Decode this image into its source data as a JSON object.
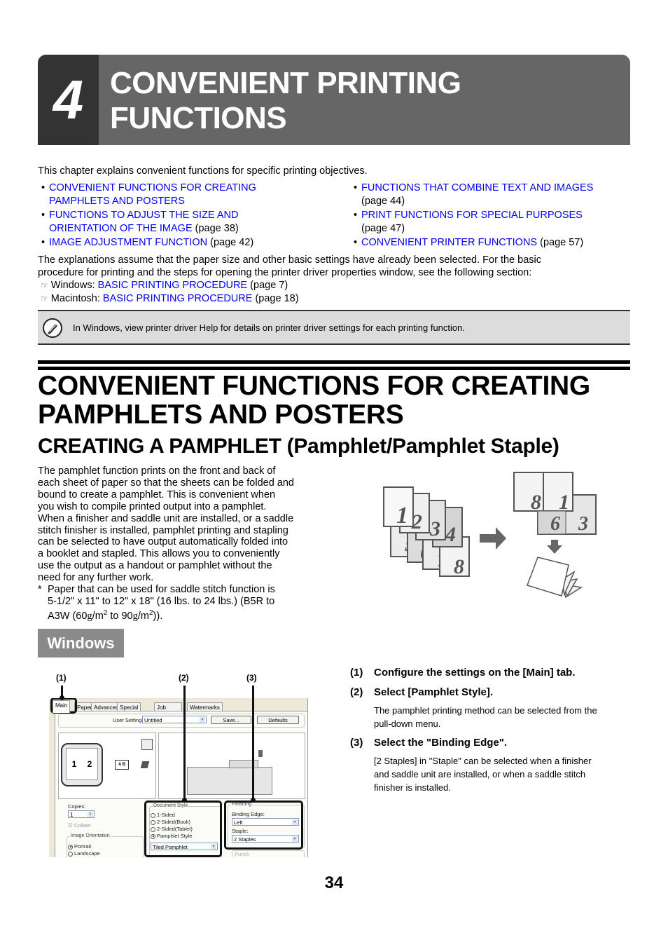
{
  "chapter": {
    "number": "4",
    "title_line1": "CONVENIENT PRINTING",
    "title_line2": "FUNCTIONS"
  },
  "intro": "This chapter explains convenient functions for specific printing objectives.",
  "toc": {
    "left": [
      {
        "link_l1": "CONVENIENT FUNCTIONS FOR CREATING",
        "link_l2": "PAMPHLETS AND POSTERS",
        "page": ""
      },
      {
        "link_l1": "FUNCTIONS TO ADJUST THE SIZE AND",
        "link_l2": "ORIENTATION OF THE IMAGE",
        "page": " (page 38)"
      },
      {
        "link_l1": "IMAGE ADJUSTMENT FUNCTION",
        "link_l2": "",
        "page": " (page 42)"
      }
    ],
    "right": [
      {
        "link": "FUNCTIONS THAT COMBINE TEXT AND IMAGES",
        "page": "(page 44)"
      },
      {
        "link": "PRINT FUNCTIONS FOR SPECIAL PURPOSES",
        "page": "(page 47)"
      },
      {
        "link": "CONVENIENT PRINTER FUNCTIONS",
        "page": " (page 57)"
      }
    ],
    "bullet": "•"
  },
  "assumption": {
    "line1": "The explanations assume that the paper size and other basic settings have already been selected. For the basic",
    "line2": "procedure for printing and the steps for opening the printer driver properties window, see the following section:",
    "refs": [
      {
        "icon": "☞",
        "os": "Windows: ",
        "link": "BASIC PRINTING PROCEDURE",
        "page": " (page 7)"
      },
      {
        "icon": "☞",
        "os": "Macintosh: ",
        "link": "BASIC PRINTING PROCEDURE",
        "page": " (page 18)"
      }
    ]
  },
  "note": {
    "icon": "pencil-note-icon",
    "text": "In Windows, view printer driver Help for details on printer driver settings for each printing function."
  },
  "section": {
    "title_line1": "CONVENIENT FUNCTIONS FOR CREATING",
    "title_line2": "PAMPHLETS AND POSTERS",
    "subtitle": "CREATING A PAMPHLET (Pamphlet/Pamphlet Staple)"
  },
  "body": {
    "lines": [
      "The pamphlet function prints on the front and back of",
      "each sheet of paper so that the sheets can be folded and",
      "bound to create a pamphlet. This is convenient when",
      "you wish to compile printed output into a pamphlet.",
      "When a finisher and saddle unit are installed, or a saddle",
      "stitch finisher is installed, pamphlet printing and stapling",
      "can be selected to have output automatically folded into",
      "a booklet and stapled. This allows you to conveniently",
      "use the output as a handout or pamphlet without the",
      "need for any further work."
    ],
    "footnote": {
      "star": "*",
      "l1": "Paper that can be used for saddle stitch function is",
      "l2": "5-1/2\" x 11\" to 12\" x 18\" (16 lbs. to 24 lbs.) (B5R to",
      "l3a": "A3W (60",
      "g": "g",
      "m": "/m",
      "sup": "2",
      "to": " to 90",
      "end": "))."
    }
  },
  "illustration": {
    "pages": [
      "1",
      "2",
      "3",
      "4",
      "5",
      "6",
      "7",
      "8"
    ],
    "spread_top": [
      "8",
      "1"
    ],
    "spread_bottom": [
      "6",
      "3"
    ]
  },
  "windows_label": "Windows",
  "callouts": [
    "(1)",
    "(2)",
    "(3)"
  ],
  "steps": [
    {
      "num": "(1)",
      "title": "Configure the settings on the [Main] tab.",
      "desc": []
    },
    {
      "num": "(2)",
      "title": "Select [Pamphlet Style].",
      "desc": [
        "The pamphlet printing method can be selected from the",
        "pull-down menu."
      ]
    },
    {
      "num": "(3)",
      "title": "Select the \"Binding Edge\".",
      "desc": [
        "[2 Staples] in \"Staple\" can be selected when a finisher",
        "and saddle unit are installed, or when a saddle stitch",
        "finisher is installed."
      ]
    }
  ],
  "dialog": {
    "tabs": [
      "Main",
      "Paper",
      "Advanced",
      "Special Modes",
      "Job Handling",
      "Watermarks"
    ],
    "user_settings_label": "User Settings:",
    "user_settings_value": "Untitled",
    "save_button": "Save...",
    "defaults_button": "Defaults",
    "preview_pages": [
      "1",
      "2"
    ],
    "preview_ab": "A B",
    "copies_label": "Copies:",
    "copies_value": "1",
    "collate_label": "Collate",
    "orientation_label": "Image Orientation",
    "orientation_options": [
      "Portrait",
      "Landscape"
    ],
    "orientation_selected": "Portrait",
    "doc_style_label": "Document Style",
    "doc_style_options": [
      "1-Sided",
      "2-Sided(Book)",
      "2-Sided(Tablet)",
      "Pamphlet Style"
    ],
    "doc_style_selected": "Pamphlet Style",
    "pamphlet_value": "Tiled Pamphlet",
    "finishing_label": "Finishing",
    "binding_edge_label": "Binding Edge:",
    "binding_edge_value": "Left",
    "staple_label": "Staple:",
    "staple_value": "2 Staples",
    "punch_label": "Punch"
  },
  "page_number": "34",
  "colors": {
    "link": "#0000ee",
    "chapter_bg": "#666666",
    "chapter_num_bg": "#333333",
    "note_bg": "#dcdcdc",
    "windows_tab_bg": "#8a8a8a"
  }
}
